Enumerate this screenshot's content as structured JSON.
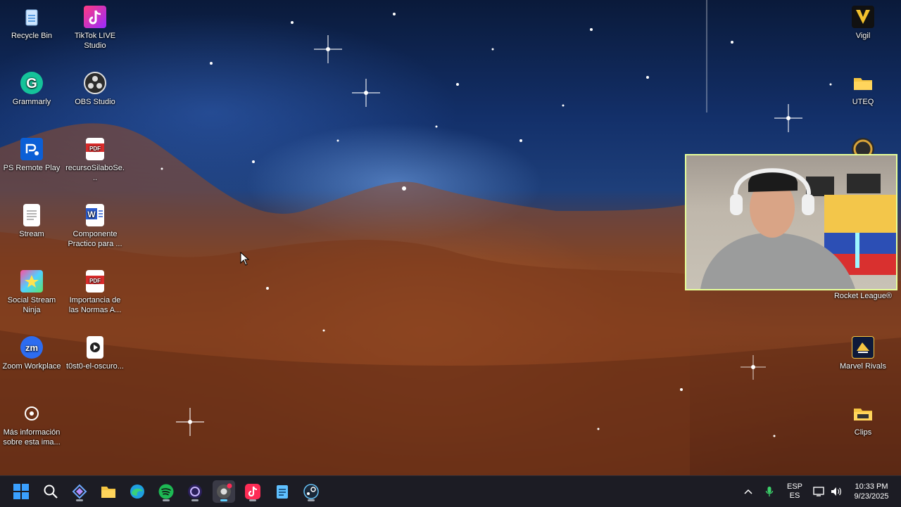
{
  "desktop": {
    "icons_left": [
      {
        "label": "Recycle Bin",
        "icon": "recycle-bin-icon"
      },
      {
        "label": "TikTok LIVE Studio",
        "icon": "tiktok-live-icon"
      },
      {
        "label": "Grammarly",
        "icon": "grammarly-icon"
      },
      {
        "label": "OBS Studio",
        "icon": "obs-icon"
      },
      {
        "label": "PS Remote Play",
        "icon": "ps-remote-play-icon"
      },
      {
        "label": "recursoSilaboSe...",
        "icon": "pdf-icon"
      },
      {
        "label": "Stream",
        "icon": "text-file-icon"
      },
      {
        "label": "Componente Practico para ...",
        "icon": "word-icon"
      },
      {
        "label": "Social Stream Ninja",
        "icon": "social-stream-icon"
      },
      {
        "label": "Importancia de las Normas A...",
        "icon": "pdf-icon"
      },
      {
        "label": "Zoom Workplace",
        "icon": "zoom-icon"
      },
      {
        "label": "t0st0-el-oscuro...",
        "icon": "video-file-icon"
      },
      {
        "label": "Más información sobre esta ima...",
        "icon": "camera-info-icon"
      }
    ],
    "icons_right": [
      {
        "label": "Vigil",
        "icon": "vigil-icon"
      },
      {
        "label": "UTEQ",
        "icon": "folder-icon"
      },
      {
        "label": "Rocket League®",
        "icon": "rocket-league-icon"
      },
      {
        "label": "Marvel Rivals",
        "icon": "marvel-rivals-icon"
      },
      {
        "label": "Clips",
        "icon": "folder-icon"
      }
    ]
  },
  "taskbar": {
    "apps": [
      "start-icon",
      "search-icon",
      "app-diamond-icon",
      "file-explorer-icon",
      "edge-icon",
      "spotify-icon",
      "obs-app-icon",
      "chrome-dev-icon",
      "tiktok-icon",
      "notepad-icon",
      "steam-icon"
    ],
    "tray": {
      "lang_top": "ESP",
      "lang_bottom": "ES",
      "time": "10:33 PM",
      "date": "9/23/2025"
    }
  },
  "colors": {
    "taskbar_bg": "#1c1c24",
    "webcam_border": "#e7ff9a",
    "tiktok_red": "#fe2c55",
    "spotify_green": "#1db954",
    "windows_blue": "#3aa0ff"
  }
}
